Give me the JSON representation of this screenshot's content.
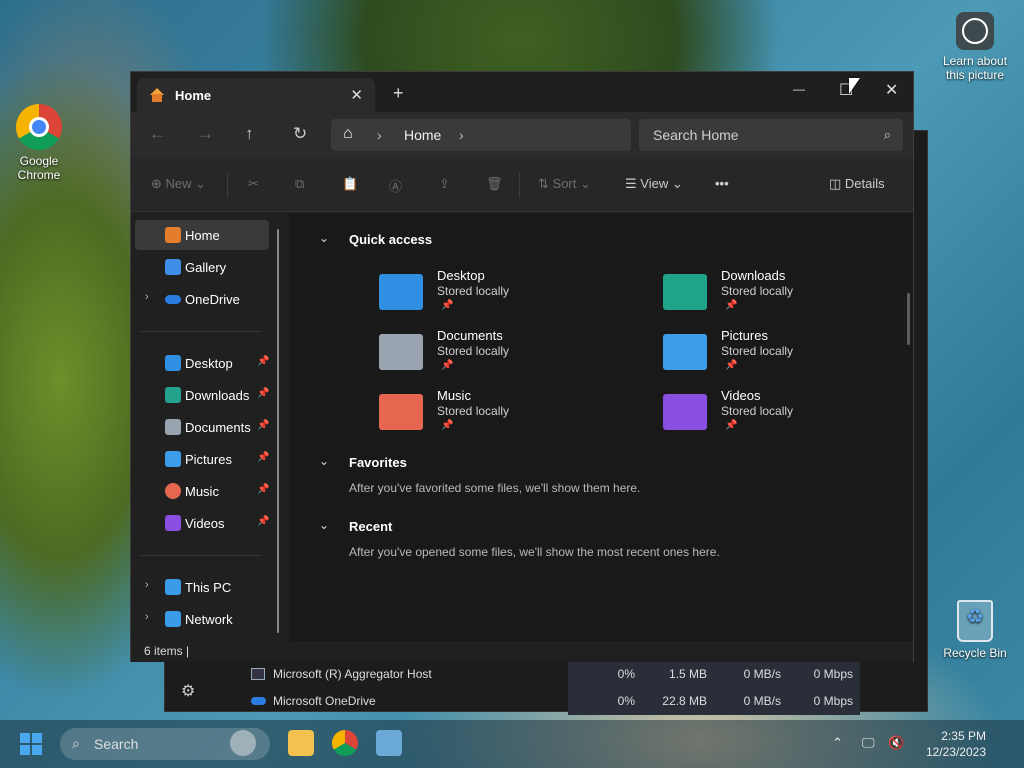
{
  "desktop": {
    "chrome_label": "Google Chrome",
    "learn_label": "Learn about this picture",
    "recycle_label": "Recycle Bin"
  },
  "taskmgr_rows": [
    {
      "name": "Microsoft (R) Aggregator Host",
      "cpu": "0%",
      "mem": "1.5 MB",
      "disk": "0 MB/s",
      "net": "0 Mbps"
    },
    {
      "name": "Microsoft OneDrive",
      "cpu": "0%",
      "mem": "22.8 MB",
      "disk": "0 MB/s",
      "net": "0 Mbps"
    }
  ],
  "explorer": {
    "tab_title": "Home",
    "tab_close": "✕",
    "tab_add": "+",
    "window_controls": {
      "minimize": "—",
      "maximize": "☐",
      "close": "✕"
    },
    "nav": {
      "back": "←",
      "forward": "→",
      "up": "↑",
      "refresh": "↻"
    },
    "address": {
      "home_glyph": "⌂",
      "sep": "›",
      "location": "Home"
    },
    "search_placeholder": "Search Home",
    "toolbar": {
      "new": "New",
      "sort": "Sort",
      "view": "View",
      "more": "•••",
      "details": "Details",
      "cut": "✂",
      "copy": "⧉",
      "paste": "📋",
      "rename": "Ⓐ",
      "share": "⇪",
      "delete": "🗑"
    },
    "sidebar": {
      "top": [
        {
          "label": "Home",
          "icon": "home-icon",
          "color": "#e37c2b"
        },
        {
          "label": "Gallery",
          "icon": "gallery-icon",
          "color": "#3d8ee6"
        },
        {
          "label": "OneDrive",
          "icon": "onedrive-icon",
          "color": "#2a7de1"
        }
      ],
      "pinned": [
        {
          "label": "Desktop",
          "icon": "desktop-icon",
          "color": "#2e8fe3"
        },
        {
          "label": "Downloads",
          "icon": "downloads-icon",
          "color": "#23a18a"
        },
        {
          "label": "Documents",
          "icon": "documents-icon",
          "color": "#9aa4b0"
        },
        {
          "label": "Pictures",
          "icon": "pictures-icon",
          "color": "#3d9de8"
        },
        {
          "label": "Music",
          "icon": "music-icon",
          "color": "#e6664f"
        },
        {
          "label": "Videos",
          "icon": "videos-icon",
          "color": "#8a4fe0"
        }
      ],
      "bottom": [
        {
          "label": "This PC",
          "icon": "pc-icon",
          "color": "#3a9be6"
        },
        {
          "label": "Network",
          "icon": "network-icon",
          "color": "#3a9be6"
        }
      ]
    },
    "quick_access": {
      "title": "Quick access",
      "items": [
        {
          "name": "Desktop",
          "sub": "Stored locally",
          "color": "#2e8fe3"
        },
        {
          "name": "Downloads",
          "sub": "Stored locally",
          "color": "#1fa389"
        },
        {
          "name": "Documents",
          "sub": "Stored locally",
          "color": "#9aa4b0"
        },
        {
          "name": "Pictures",
          "sub": "Stored locally",
          "color": "#3d9de8"
        },
        {
          "name": "Music",
          "sub": "Stored locally",
          "color": "#e6664f"
        },
        {
          "name": "Videos",
          "sub": "Stored locally",
          "color": "#8a4fe0"
        }
      ]
    },
    "favorites": {
      "title": "Favorites",
      "hint": "After you've favorited some files, we'll show them here."
    },
    "recent": {
      "title": "Recent",
      "hint": "After you've opened some files, we'll show the most recent ones here."
    },
    "status": "6 items  |"
  },
  "taskbar": {
    "search_label": "Search",
    "clock_time": "2:35 PM",
    "clock_date": "12/23/2023"
  }
}
